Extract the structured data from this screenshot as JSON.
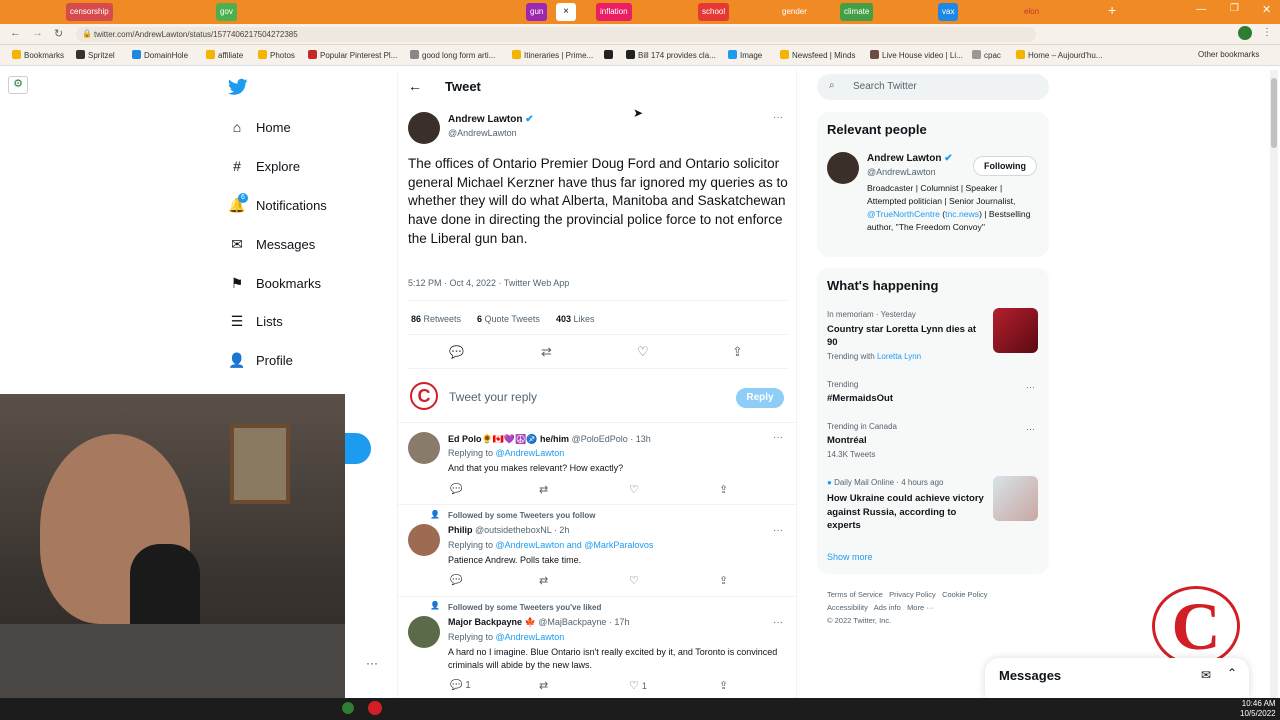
{
  "browser": {
    "tabs": [
      {
        "label": "censorship",
        "color": "#d64b4b"
      },
      {
        "label": "gov",
        "color": "#4caf50"
      },
      {
        "label": "gun",
        "color": "#9c27b0"
      },
      {
        "label": "inflation",
        "color": "#e91e63"
      },
      {
        "label": "school",
        "color": "#e53935"
      },
      {
        "label": "gender",
        "color": "#f08a24"
      },
      {
        "label": "climate",
        "color": "#43a047"
      },
      {
        "label": "vax",
        "color": "#1e88e5"
      },
      {
        "label": "elon",
        "color": "#f08a24"
      }
    ],
    "url": "twitter.com/AndrewLawton/status/1577406217504272385",
    "bookmarks": [
      "Bookmarks",
      "Spritzel",
      "DomainHole",
      "affiliate",
      "Photos",
      "Popular Pinterest Pl...",
      "good long form arti...",
      "Itineraries | Prime...",
      "Bill 174 provides cla...",
      "Image",
      "Newsfeed | Minds",
      "Live House video | Li...",
      "cpac",
      "Home – Aujourd'hu...",
      "Other bookmarks"
    ]
  },
  "nav": {
    "items": [
      {
        "label": "Home",
        "icon": "home-icon",
        "glyph": "⌂"
      },
      {
        "label": "Explore",
        "icon": "hashtag-icon",
        "glyph": "#"
      },
      {
        "label": "Notifications",
        "icon": "bell-icon",
        "glyph": "🔔"
      },
      {
        "label": "Messages",
        "icon": "mail-icon",
        "glyph": "✉"
      },
      {
        "label": "Bookmarks",
        "icon": "bookmark-icon",
        "glyph": "🔖"
      },
      {
        "label": "Lists",
        "icon": "list-icon",
        "glyph": "☰"
      },
      {
        "label": "Profile",
        "icon": "person-icon",
        "glyph": "👤"
      }
    ],
    "notification_count": "6",
    "more_dots": "···"
  },
  "tweet": {
    "header_title": "Tweet",
    "author_name": "Andrew Lawton",
    "author_handle": "@AndrewLawton",
    "text": "The offices of Ontario Premier Doug Ford and Ontario solicitor general Michael Kerzner have thus far ignored my queries as to whether they will do what Alberta, Manitoba and Saskatchewan have done in directing the provincial police force to not enforce the Liberal gun ban.",
    "meta": "5:12 PM · Oct 4, 2022 · Twitter Web App",
    "retweets_count": "86",
    "retweets_label": "Retweets",
    "quotes_count": "6",
    "quotes_label": "Quote Tweets",
    "likes_count": "403",
    "likes_label": "Likes",
    "reply_placeholder": "Tweet your reply",
    "reply_button": "Reply"
  },
  "replies": [
    {
      "social": "",
      "name": "Ed Polo🌻🇨🇦💜☮️♐ he/him",
      "handle": "@PoloEdPolo · 13h",
      "replying_prefix": "Replying to ",
      "replying_to": "@AndrewLawton",
      "text": "And that you makes relevant? How exactly?",
      "replies": "",
      "retweets": "",
      "likes": ""
    },
    {
      "social": "Followed by some Tweeters you follow",
      "name": "Philip",
      "handle": "@outsidetheboxNL · 2h",
      "replying_prefix": "Replying to ",
      "replying_to": "@AndrewLawton and @MarkParalovos",
      "text": "Patience Andrew. Polls take time.",
      "replies": "",
      "retweets": "",
      "likes": ""
    },
    {
      "social": "Followed by some Tweeters you've liked",
      "name": "Major Backpayne 🍁",
      "handle": "@MajBackpayne · 17h",
      "replying_prefix": "Replying to ",
      "replying_to": "@AndrewLawton",
      "text": "A hard no I imagine. Blue Ontario isn't really excited by it, and Toronto is convinced criminals will abide by the new laws.",
      "replies": "1",
      "retweets": "",
      "likes": "1"
    }
  ],
  "search": {
    "placeholder": "Search Twitter"
  },
  "relevant": {
    "title": "Relevant people",
    "name": "Andrew Lawton",
    "handle": "@AndrewLawton",
    "follow_label": "Following",
    "bio_1": "Broadcaster | Columnist | Speaker | Attempted politician | Senior Journalist, ",
    "bio_link": "@TrueNorthCentre",
    "bio_2": " (",
    "bio_link2": "tnc.news",
    "bio_3": ") | Bestselling author, \"The Freedom Convoy\""
  },
  "trends": {
    "title": "What's happening",
    "items": [
      {
        "context": "In memoriam · Yesterday",
        "title": "Country star Loretta Lynn dies at 90",
        "sub_prefix": "Trending with ",
        "sub_link": "Loretta Lynn"
      },
      {
        "context": "Trending",
        "title": "#MermaidsOut",
        "sub_prefix": "",
        "sub_link": ""
      },
      {
        "context": "Trending in Canada",
        "title": "Montréal",
        "sub_prefix": "14.3K Tweets",
        "sub_link": ""
      },
      {
        "context": "Daily Mail Online · 4 hours ago",
        "title": "How Ukraine could achieve victory against Russia, according to experts",
        "sub_prefix": "",
        "sub_link": ""
      }
    ],
    "show_more": "Show more"
  },
  "footer": {
    "links": [
      "Terms of Service",
      "Privacy Policy",
      "Cookie Policy",
      "Accessibility",
      "Ads info",
      "More ···"
    ],
    "copyright": "© 2022 Twitter, Inc."
  },
  "messages_drawer": {
    "title": "Messages"
  },
  "taskbar": {
    "time": "10:46 AM",
    "date": "10/5/2022"
  },
  "colors": {
    "twitter_blue": "#1d9bf0",
    "tabbar": "#f08a24",
    "red_logo": "#d21f26"
  }
}
